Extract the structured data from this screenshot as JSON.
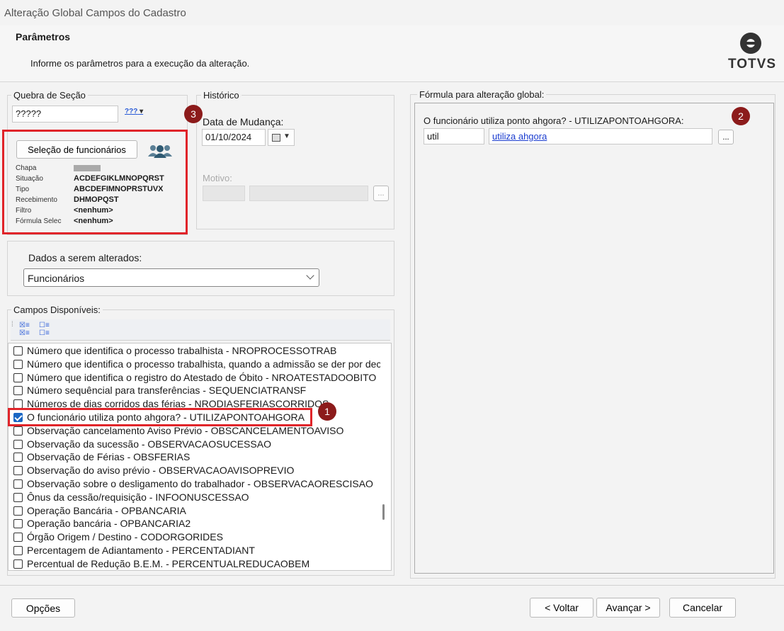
{
  "window": {
    "title": "Alteração Global Campos do Cadastro"
  },
  "header": {
    "title": "Parâmetros",
    "subtitle": "Informe os parâmetros para a execução da alteração.",
    "logo_text": "TOTVS"
  },
  "quebra_secao": {
    "legend": "Quebra de Seção",
    "value": "?????",
    "lookup_icon": "???"
  },
  "selecao": {
    "button_label": "Seleção de funcionários",
    "users_icon": "users-icon",
    "fields": [
      {
        "label": "Chapa",
        "value": ""
      },
      {
        "label": "Situação",
        "value": "ACDEFGIKLMNOPQRST"
      },
      {
        "label": "Tipo",
        "value": "ABCDEFIMNOPRSTUVX"
      },
      {
        "label": "Recebimento",
        "value": "DHMOPQST"
      },
      {
        "label": "Filtro",
        "value": "<nenhum>"
      },
      {
        "label": "Fórmula Selec",
        "value": "<nenhum>"
      }
    ]
  },
  "historico": {
    "legend": "Histórico",
    "data_label": "Data de Mudança:",
    "data_value": "01/10/2024",
    "motivo_label": "Motivo:",
    "ellipsis": "..."
  },
  "dados": {
    "label": "Dados a serem alterados:",
    "selected": "Funcionários"
  },
  "campos": {
    "legend": "Campos Disponíveis:",
    "items": [
      {
        "text": "Número que identifica o processo trabalhista - NROPROCESSOTRAB",
        "checked": false
      },
      {
        "text": "Número que identifica o processo trabalhista, quando a admissão se der por decisão",
        "checked": false
      },
      {
        "text": "Número que identifica o registro do Atestado de Óbito - NROATESTADOOBITO",
        "checked": false
      },
      {
        "text": "Número sequêncial para transferências - SEQUENCIATRANSF",
        "checked": false
      },
      {
        "text": "Números de dias corridos das férias - NRODIASFERIASCORRIDOS",
        "checked": false
      },
      {
        "text": "O funcionário utiliza ponto ahgora? - UTILIZAPONTOAHGORA",
        "checked": true
      },
      {
        "text": "Observação cancelamento Aviso Prévio - OBSCANCELAMENTOAVISO",
        "checked": false
      },
      {
        "text": "Observação da sucessão - OBSERVACAOSUCESSAO",
        "checked": false
      },
      {
        "text": "Observação de Férias - OBSFERIAS",
        "checked": false
      },
      {
        "text": "Observação do aviso prévio - OBSERVACAOAVISOPREVIO",
        "checked": false
      },
      {
        "text": "Observação sobre o desligamento do trabalhador - OBSERVACAORESCISAO",
        "checked": false
      },
      {
        "text": "Ônus da cessão/requisição - INFOONUSCESSAO",
        "checked": false
      },
      {
        "text": "Operação Bancária - OPBANCARIA",
        "checked": false
      },
      {
        "text": "Operação bancária - OPBANCARIA2",
        "checked": false
      },
      {
        "text": "Órgão Origem / Destino - CODORGORIDES",
        "checked": false
      },
      {
        "text": "Percentagem de Adiantamento - PERCENTADIANT",
        "checked": false
      },
      {
        "text": "Percentual de Redução B.E.M. - PERCENTUALREDUCAOBEM",
        "checked": false
      }
    ]
  },
  "formula": {
    "legend": "Fórmula para alteração global:",
    "field_label": "O funcionário utiliza ponto ahgora? - UTILIZAPONTOAHGORA:",
    "code": "util",
    "link_text": "utiliza ahgora",
    "ellipsis": "..."
  },
  "badges": {
    "one": "1",
    "two": "2",
    "three": "3"
  },
  "footer": {
    "opcoes": "Opções",
    "voltar": "< Voltar",
    "avancar": "Avançar >",
    "cancelar": "Cancelar"
  },
  "colors": {
    "highlight_red": "#e0242a",
    "badge": "#8c1b1b",
    "check_blue": "#1a66c4",
    "link": "#1a3ccf"
  }
}
